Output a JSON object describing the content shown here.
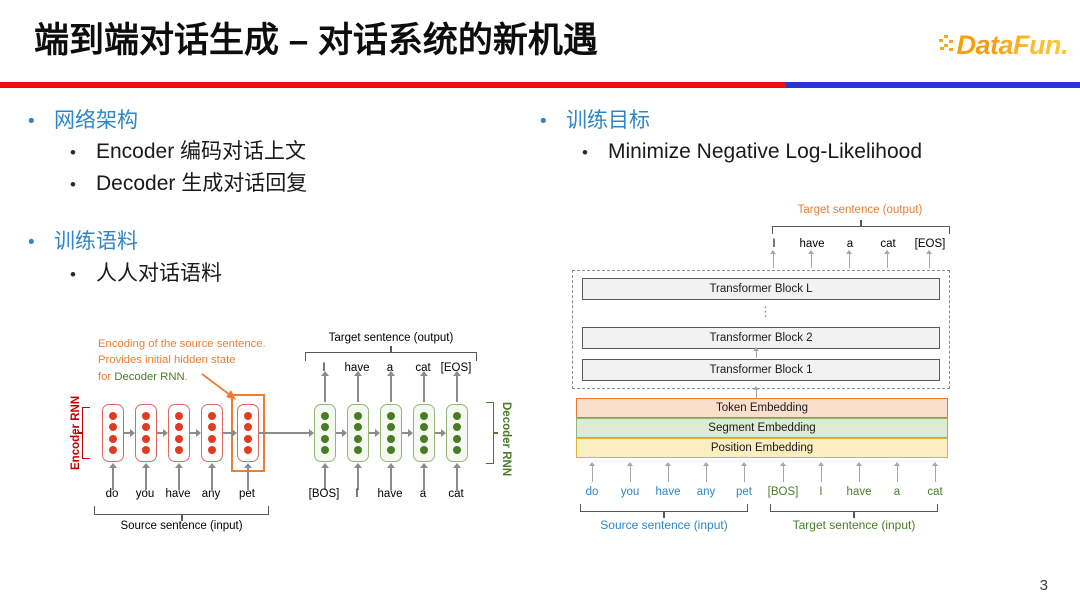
{
  "header": {
    "title": "端到端对话生成 – 对话系统的新机遇",
    "logo_text": "DataFun.",
    "divider_red": "#e8120b",
    "divider_blue": "#2b34d6"
  },
  "bullets": {
    "left": [
      {
        "level": 1,
        "text": "网络架构"
      },
      {
        "level": 2,
        "text": "Encoder 编码对话上文"
      },
      {
        "level": 2,
        "text": "Decoder 生成对话回复"
      },
      {
        "level": 1,
        "text": "训练语料"
      },
      {
        "level": 2,
        "text": "人人对话语料"
      }
    ],
    "right": [
      {
        "level": 1,
        "text": "训练目标"
      },
      {
        "level": 2,
        "text": "Minimize Negative Log-Likelihood"
      }
    ]
  },
  "diagram_rnn": {
    "annotation_line1": "Encoding of the source sentence.",
    "annotation_line2": "Provides initial hidden state",
    "annotation_line3_pre": "for ",
    "annotation_line3_green": "Decoder RNN",
    "annotation_line3_post": ".",
    "encoder_label": "Encoder RNN",
    "decoder_label": "Decoder RNN",
    "encoder_inputs": [
      "do",
      "you",
      "have",
      "any",
      "pet"
    ],
    "decoder_inputs": [
      "[BOS]",
      "I",
      "have",
      "a",
      "cat"
    ],
    "decoder_outputs": [
      "I",
      "have",
      "a",
      "cat",
      "[EOS]"
    ],
    "source_caption": "Source sentence (input)",
    "target_caption": "Target sentence (output)",
    "encoder_color": "#e03c1f",
    "decoder_color": "#4c7b28",
    "highlight_color": "#ed7d31"
  },
  "diagram_transformer": {
    "target_output_caption": "Target sentence (output)",
    "outputs": [
      "I",
      "have",
      "a",
      "cat",
      "[EOS]"
    ],
    "blocks": [
      "Transformer Block L",
      "Transformer Block 2",
      "Transformer Block 1"
    ],
    "ellipsis": "⋮",
    "embeddings": [
      "Token Embedding",
      "Segment Embedding",
      "Position Embedding"
    ],
    "source_tokens": [
      "do",
      "you",
      "have",
      "any",
      "pet"
    ],
    "target_tokens": [
      "[BOS]",
      "I",
      "have",
      "a",
      "cat"
    ],
    "source_caption": "Source sentence (input)",
    "target_caption": "Target sentence (input)",
    "source_color": "#2e86c8",
    "target_color": "#4c7b28",
    "output_caption_color": "#ed7d31"
  },
  "page_number": "3"
}
